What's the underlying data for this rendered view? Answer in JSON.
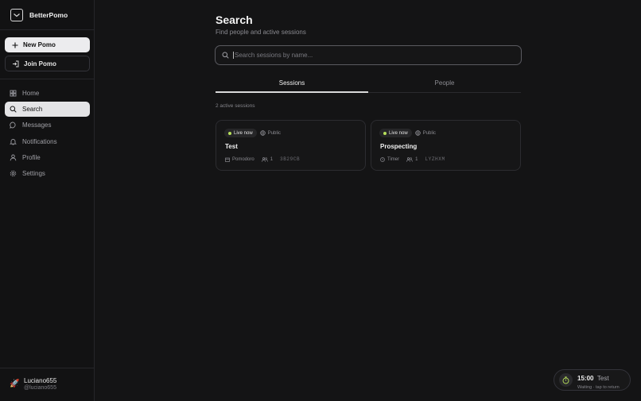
{
  "sidebar": {
    "brand": {
      "name": "BetterPomo",
      "icon": "logo-icon"
    },
    "new_button": {
      "label": "New Pomo",
      "icon": "plus-icon"
    },
    "join_button": {
      "label": "Join Pomo",
      "icon": "enter-icon"
    },
    "nav": [
      {
        "label": "Home",
        "icon": "home-icon"
      },
      {
        "label": "Search",
        "icon": "search-icon",
        "active": true
      },
      {
        "label": "Messages",
        "icon": "message-icon"
      },
      {
        "label": "Notifications",
        "icon": "bell-icon"
      },
      {
        "label": "Profile",
        "icon": "user-icon"
      },
      {
        "label": "Settings",
        "icon": "gear-icon"
      }
    ],
    "user": {
      "name": "Luciano655",
      "handle": "@luciano655",
      "avatar": "rocket-icon"
    }
  },
  "main": {
    "title": "Search",
    "subtitle": "Find people and active sessions",
    "search": {
      "placeholder": "Search sessions by name..."
    },
    "tabs": [
      {
        "label": "Sessions",
        "active": true
      },
      {
        "label": "People",
        "active": false
      }
    ],
    "result_count": "2 active sessions",
    "sessions": [
      {
        "status": "Live now",
        "visibility": "Public",
        "title": "Test",
        "mode": "Pomodoro",
        "participants": "1",
        "code": "3B29CB"
      },
      {
        "status": "Live now",
        "visibility": "Public",
        "title": "Prospecting",
        "mode": "Timer",
        "participants": "1",
        "code": "LYZHXM"
      }
    ]
  },
  "timer_pill": {
    "time": "15:00",
    "session": "Test",
    "hint": "Waiting · tap to return"
  },
  "colors": {
    "background": "#141415",
    "live_dot": "#b7e05b",
    "active_nav": "#e4e4e6"
  }
}
